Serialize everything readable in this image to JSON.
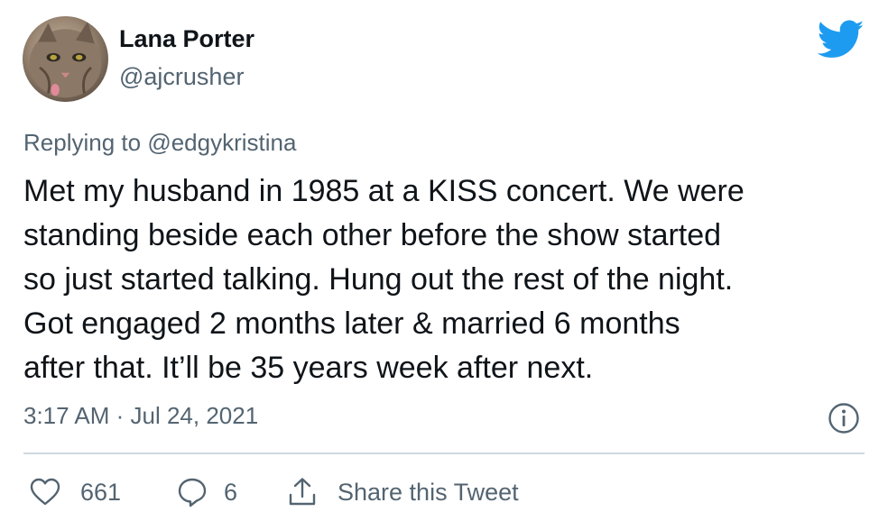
{
  "author": {
    "name": "Lana Porter",
    "handle": "@ajcrusher",
    "avatar": "cat-photo"
  },
  "reply_context": {
    "prefix": "Replying to",
    "mention": "@edgykristina"
  },
  "tweet": {
    "text": "Met my husband in 1985 at a KISS concert. We were\nstanding beside each other before the show started\nso just started talking. Hung out the rest of the night.\nGot engaged 2 months later & married 6 months\nafter that. It’ll be 35 years week after next.",
    "timestamp": "3:17 AM · Jul 24, 2021"
  },
  "actions": {
    "likes": "661",
    "replies": "6",
    "share_label": "Share this Tweet"
  },
  "icons": {
    "brand": "twitter-bird-icon",
    "info": "info-icon",
    "like": "heart-icon",
    "reply": "reply-bubble-icon",
    "share": "share-icon"
  },
  "colors": {
    "brand": "#1d9bf0",
    "text": "#0f1419",
    "secondary": "#536471",
    "divider": "#cfd9de"
  }
}
